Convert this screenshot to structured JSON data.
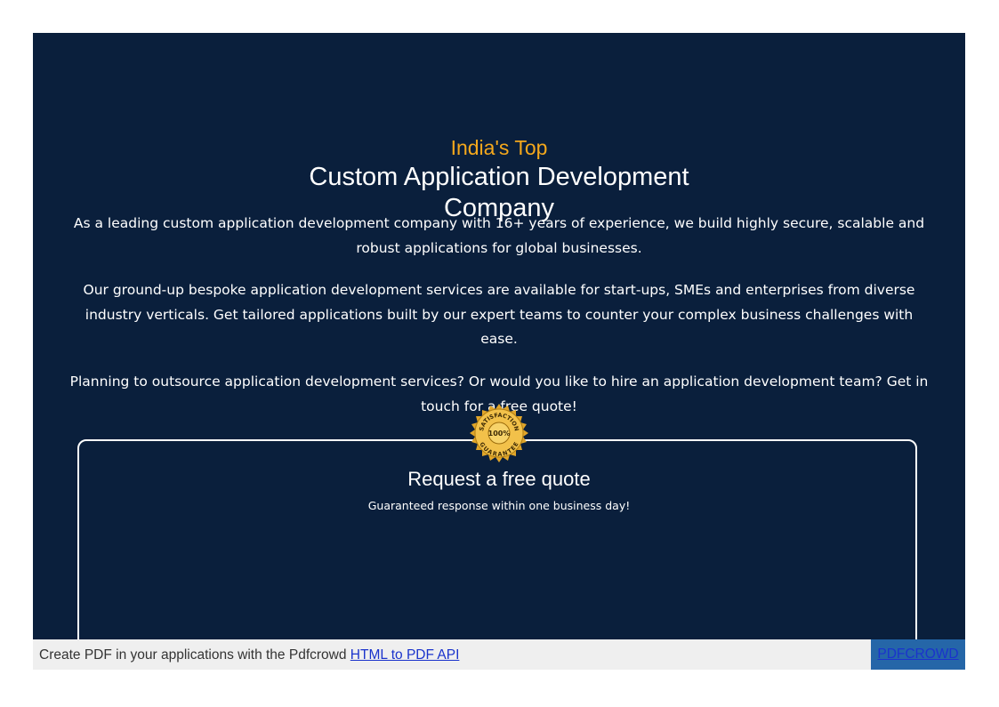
{
  "hero": {
    "eyebrow": "India's Top",
    "heading": "Custom Application Development Company",
    "paragraph_1": "As a leading custom application development company with 16+ years of experience, we build highly secure, scalable and robust  applications for global businesses.",
    "paragraph_2": "Our ground-up bespoke application development services are available for start-ups, SMEs and enterprises from diverse industry  verticals. Get tailored applications built by our expert teams to counter your complex business challenges with ease.",
    "paragraph_3": "Planning to outsource application development services? Or would you like to hire an application development team? Get in touch for a  free quote!",
    "background_color": "#0a1f3c",
    "accent_color": "#f5a81c"
  },
  "quote": {
    "badge_icon": "satisfaction-guarantee-seal",
    "badge_top_text": "SATISFACTION",
    "badge_center_text": "100%",
    "badge_bottom_text": "GUARANTEE",
    "title": "Request a free quote",
    "subtitle": "Guaranteed response within one business day!"
  },
  "footer": {
    "text": "Create PDF in your applications with the Pdfcrowd ",
    "link_label": "HTML to PDF API",
    "button_label": "PDFCROWD"
  }
}
